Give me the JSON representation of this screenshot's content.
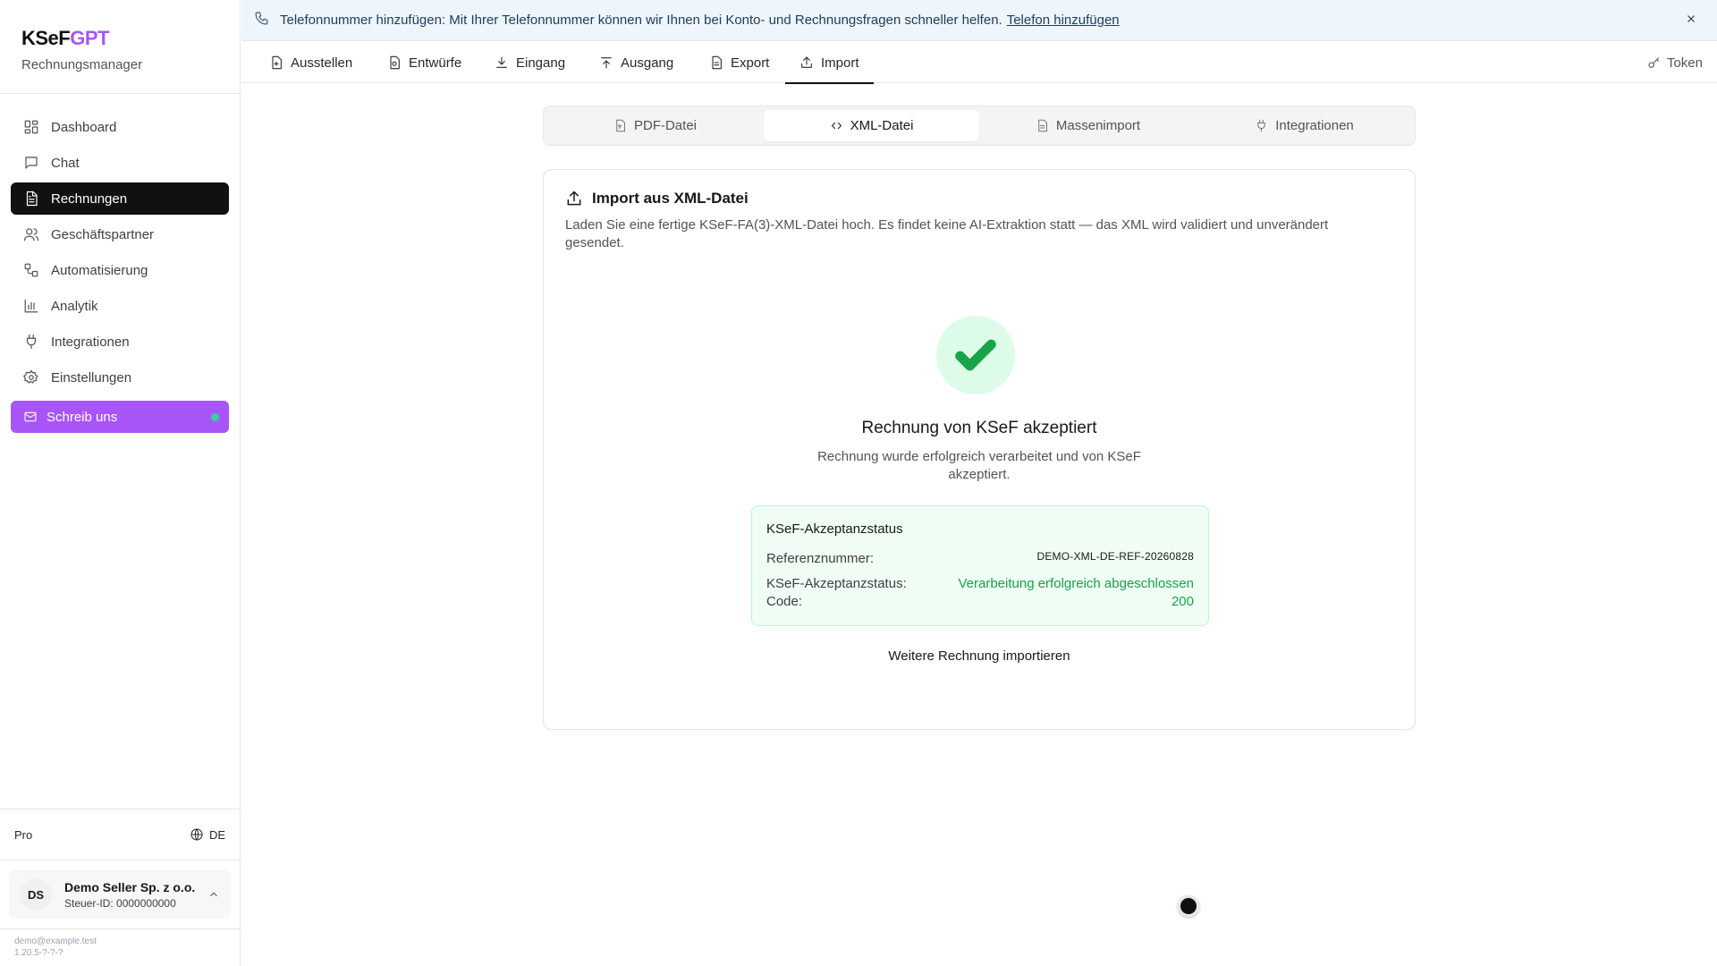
{
  "brand": {
    "name_main": "KSeF",
    "name_accent": "GPT",
    "subtitle": "Rechnungsmanager"
  },
  "sidebar": {
    "items": [
      {
        "label": "Dashboard",
        "icon": "dashboard-icon"
      },
      {
        "label": "Chat",
        "icon": "chat-icon"
      },
      {
        "label": "Rechnungen",
        "icon": "invoice-icon",
        "active": true
      },
      {
        "label": "Geschäftspartner",
        "icon": "users-icon"
      },
      {
        "label": "Automatisierung",
        "icon": "workflow-icon"
      },
      {
        "label": "Analytik",
        "icon": "bar-chart-icon"
      },
      {
        "label": "Integrationen",
        "icon": "plug-icon"
      },
      {
        "label": "Einstellungen",
        "icon": "gear-icon"
      }
    ],
    "write_us": {
      "label": "Schreib uns",
      "icon": "mail-icon"
    },
    "plan": "Pro",
    "language": "DE",
    "account": {
      "initials": "DS",
      "name": "Demo Seller Sp. z o.o.",
      "tax_id": "Steuer-ID: 0000000000"
    },
    "email": "demo@example.test",
    "version": "1.20.5-?-?-?"
  },
  "banner": {
    "text": "Telefonnummer hinzufügen: Mit Ihrer Telefonnummer können wir Ihnen bei Konto- und Rechnungsfragen schneller helfen.",
    "link": "Telefon hinzufügen"
  },
  "top_tabs": [
    {
      "label": "Ausstellen",
      "icon": "file-plus-icon"
    },
    {
      "label": "Entwürfe",
      "icon": "draft-icon"
    },
    {
      "label": "Eingang",
      "icon": "download-icon"
    },
    {
      "label": "Ausgang",
      "icon": "upload-icon"
    },
    {
      "label": "Export",
      "icon": "file-text-icon"
    },
    {
      "label": "Import",
      "icon": "import-icon",
      "active": true
    }
  ],
  "token_label": "Token",
  "sub_tabs": [
    {
      "label": "PDF-Datei",
      "icon": "pdf-file-icon"
    },
    {
      "label": "XML-Datei",
      "icon": "code-icon",
      "active": true
    },
    {
      "label": "Massenimport",
      "icon": "file-icon"
    },
    {
      "label": "Integrationen",
      "icon": "plug-icon"
    }
  ],
  "card": {
    "title": "Import aus XML-Datei",
    "description": "Laden Sie eine fertige KSeF-FA(3)-XML-Datei hoch. Es findet keine AI-Extraktion statt — das XML wird validiert und unverändert gesendet.",
    "result_title": "Rechnung von KSeF akzeptiert",
    "result_desc": "Rechnung wurde erfolgreich verarbeitet und von KSeF akzeptiert.",
    "status": {
      "title": "KSeF-Akzeptanzstatus",
      "ref_label": "Referenznummer:",
      "ref_value": "DEMO-XML-DE-REF-20260828",
      "status_label": "KSeF-Akzeptanzstatus:",
      "status_value": "Verarbeitung erfolgreich abgeschlossen",
      "code_label": "Code:",
      "code_value": "200"
    },
    "again_label": "Weitere Rechnung importieren"
  },
  "colors": {
    "accent": "#a855f7",
    "success": "#16a34a",
    "active_nav": "#111113"
  }
}
